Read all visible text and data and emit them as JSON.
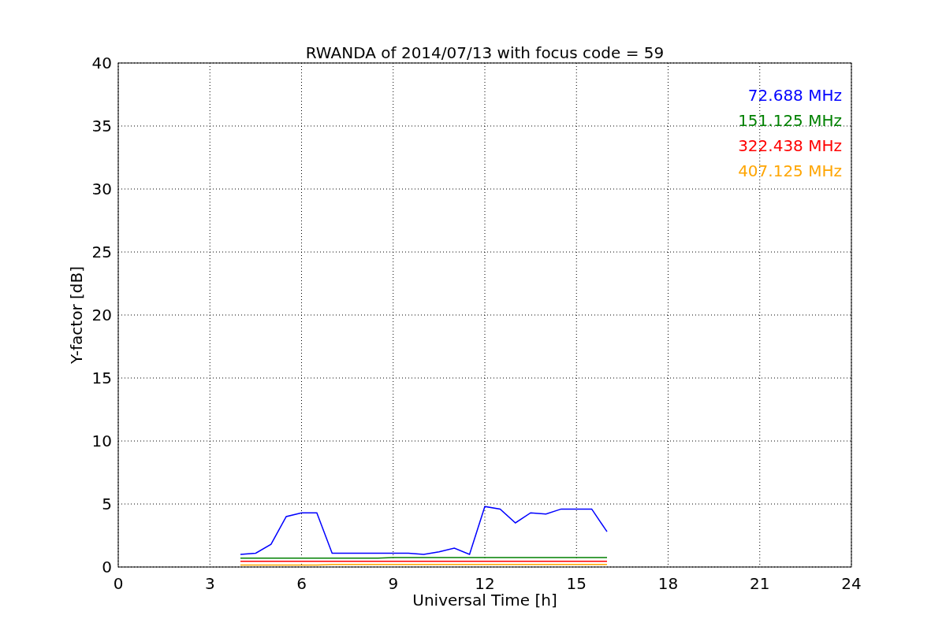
{
  "chart_data": {
    "type": "line",
    "title": "RWANDA of 2014/07/13 with focus code = 59",
    "xlabel": "Universal Time [h]",
    "ylabel": "Y-factor [dB]",
    "x": [
      4,
      4.5,
      5,
      5.5,
      6,
      6.5,
      7,
      7.5,
      8,
      8.5,
      9,
      9.5,
      10,
      10.5,
      11,
      11.5,
      12,
      12.5,
      13,
      13.5,
      14,
      14.5,
      15,
      15.5,
      16
    ],
    "series": [
      {
        "name": "72.688 MHz",
        "color": "#0000ff",
        "values": [
          1.0,
          1.1,
          1.8,
          4.0,
          4.3,
          4.3,
          1.1,
          1.1,
          1.1,
          1.1,
          1.1,
          1.1,
          1.0,
          1.2,
          1.5,
          1.0,
          4.8,
          4.6,
          3.5,
          4.3,
          4.2,
          4.6,
          4.6,
          4.6,
          2.8
        ]
      },
      {
        "name": "151.125 MHz",
        "color": "#008000",
        "values": [
          0.7,
          0.7,
          0.7,
          0.7,
          0.7,
          0.7,
          0.7,
          0.7,
          0.7,
          0.7,
          0.75,
          0.75,
          0.75,
          0.75,
          0.75,
          0.75,
          0.75,
          0.75,
          0.75,
          0.75,
          0.75,
          0.75,
          0.75,
          0.75,
          0.75
        ]
      },
      {
        "name": "322.438 MHz",
        "color": "#ff0000",
        "values": [
          0.45,
          0.45,
          0.45,
          0.45,
          0.45,
          0.45,
          0.45,
          0.45,
          0.45,
          0.45,
          0.45,
          0.45,
          0.45,
          0.45,
          0.45,
          0.45,
          0.45,
          0.45,
          0.45,
          0.45,
          0.45,
          0.45,
          0.45,
          0.45,
          0.45
        ]
      },
      {
        "name": "407.125 MHz",
        "color": "#ffa500",
        "values": [
          0.15,
          0.15,
          0.15,
          0.15,
          0.15,
          0.15,
          0.2,
          0.2,
          0.2,
          0.2,
          0.2,
          0.2,
          0.2,
          0.2,
          0.2,
          0.2,
          0.2,
          0.2,
          0.2,
          0.2,
          0.2,
          0.2,
          0.2,
          0.2,
          0.2
        ]
      }
    ],
    "grid": true,
    "xlim": [
      0,
      24
    ],
    "ylim": [
      0,
      40
    ],
    "xticks": [
      0,
      3,
      6,
      9,
      12,
      15,
      18,
      21,
      24
    ],
    "yticks": [
      0,
      5,
      10,
      15,
      20,
      25,
      30,
      35,
      40
    ]
  }
}
